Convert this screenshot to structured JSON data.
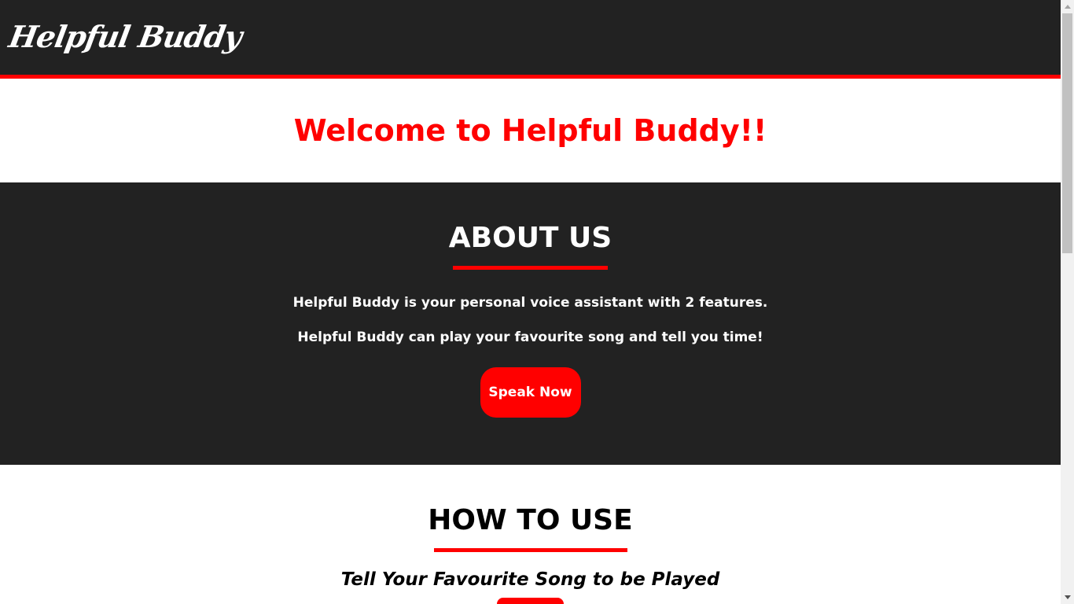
{
  "navbar": {
    "logo": "Helpful Buddy"
  },
  "welcome": {
    "heading": "Welcome to Helpful Buddy!!"
  },
  "about": {
    "title": "ABOUT US",
    "line1": "Helpful Buddy is your personal voice assistant with 2 features.",
    "line2": "Helpful Buddy can play your favourite song and tell you time!",
    "button_label": "Speak Now"
  },
  "howto": {
    "title": "HOW TO USE",
    "subtitle": "Tell Your Favourite Song to be Played"
  },
  "colors": {
    "accent": "#ff0000",
    "dark": "#222222",
    "light": "#ffffff"
  }
}
